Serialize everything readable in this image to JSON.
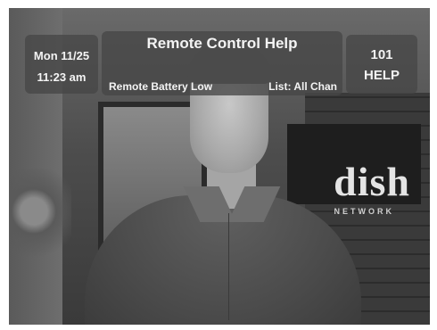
{
  "osd": {
    "date": "Mon 11/25",
    "time": "11:23 am",
    "title": "Remote Control Help",
    "status": "Remote Battery Low",
    "list": "List: All Chan",
    "channel_number": "101",
    "channel_name": "HELP"
  },
  "background": {
    "logo_text": "dish",
    "logo_subtext": "NETWORK"
  }
}
